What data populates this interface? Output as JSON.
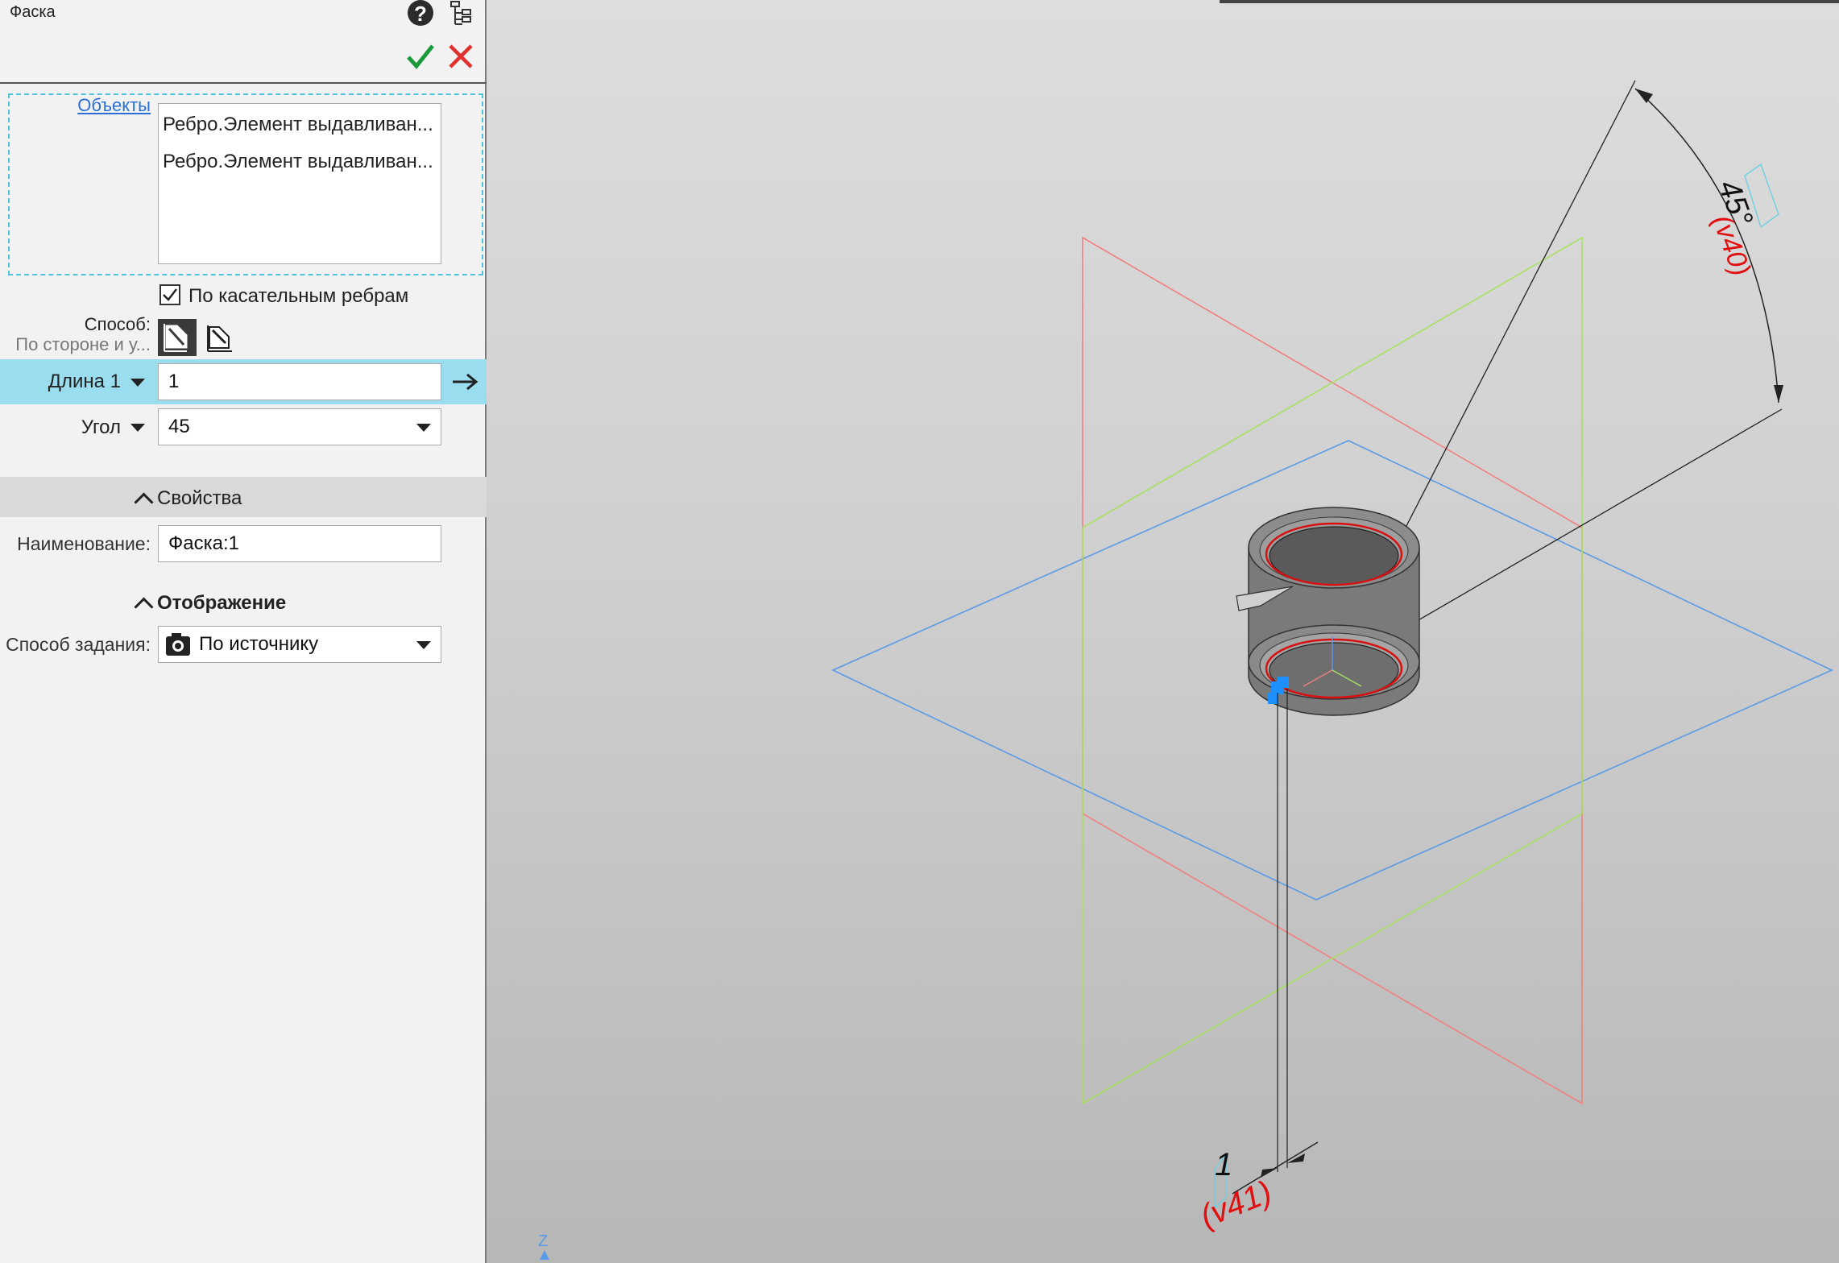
{
  "panel": {
    "title": "Фаска",
    "objects_link": "Объекты",
    "objects": [
      "Ребро.Элемент выдавливан...",
      "Ребро.Элемент выдавливан..."
    ],
    "tangent_label": "По касательным ребрам",
    "tangent_checked": true,
    "method_label": "Способ:",
    "method_value": "По стороне и у...",
    "length_label": "Длина 1",
    "length_value": "1",
    "angle_label": "Угол",
    "angle_value": "45",
    "properties_header": "Свойства",
    "name_label": "Наименование:",
    "name_value": "Фаска:1",
    "display_header": "Отображение",
    "spec_label": "Способ задания:",
    "spec_value": "По источнику"
  },
  "viewport": {
    "angle_dim_text": "45°",
    "angle_var": "(v40)",
    "length_dim_text": "1",
    "length_var": "(v41)",
    "axis_label": "Z"
  },
  "colors": {
    "accent_row": "#99ddee",
    "ok": "#1a9a3a",
    "cancel": "#e03030",
    "link": "#2a6fd6",
    "variable_red": "#e01010",
    "plane_blue": "#5a9ae6",
    "plane_red": "#f08080",
    "plane_green": "#a8e060"
  }
}
